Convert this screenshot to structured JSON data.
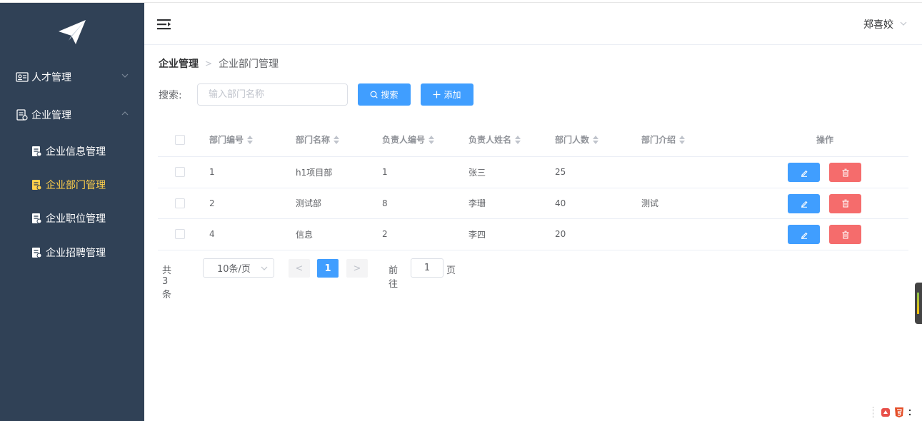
{
  "colors": {
    "sidebar_bg": "#304156",
    "accent": "#409eff",
    "danger": "#f56c6c",
    "active_menu": "#ffd04b"
  },
  "sidebar": {
    "logo_icon": "paper-plane-icon",
    "menus": [
      {
        "label": "人才管理",
        "icon": "talent-card-icon",
        "expanded": false
      },
      {
        "label": "企业管理",
        "icon": "enterprise-doc-icon",
        "expanded": true
      }
    ],
    "sub_items": [
      {
        "label": "企业信息管理",
        "active": false
      },
      {
        "label": "企业部门管理",
        "active": true
      },
      {
        "label": "企业职位管理",
        "active": false
      },
      {
        "label": "企业招聘管理",
        "active": false
      }
    ]
  },
  "header": {
    "toggle_icon": "hamburger-icon",
    "user_name": "郑喜姣"
  },
  "breadcrumb": {
    "first": "企业管理",
    "separator": ">",
    "second": "企业部门管理"
  },
  "search": {
    "label": "搜索:",
    "placeholder": "输入部门名称",
    "value": "",
    "search_button": "搜索",
    "add_button": "添加"
  },
  "table": {
    "headers": [
      "部门编号",
      "部门名称",
      "负责人编号",
      "负责人姓名",
      "部门人数",
      "部门介绍",
      "操作"
    ],
    "rows": [
      {
        "id": "1",
        "name": "h1项目部",
        "leader_id": "1",
        "leader_name": "张三",
        "count": "25",
        "intro": ""
      },
      {
        "id": "2",
        "name": "测试部",
        "leader_id": "8",
        "leader_name": "李珊",
        "count": "40",
        "intro": "测试"
      },
      {
        "id": "4",
        "name": "信息",
        "leader_id": "2",
        "leader_name": "李四",
        "count": "20",
        "intro": ""
      }
    ]
  },
  "pagination": {
    "total": "共 3 条",
    "page_size": "10条/页",
    "prev": "<",
    "current_page": "1",
    "next": ">",
    "goto_label": "前往",
    "goto_value": "1",
    "goto_suffix": "页"
  }
}
